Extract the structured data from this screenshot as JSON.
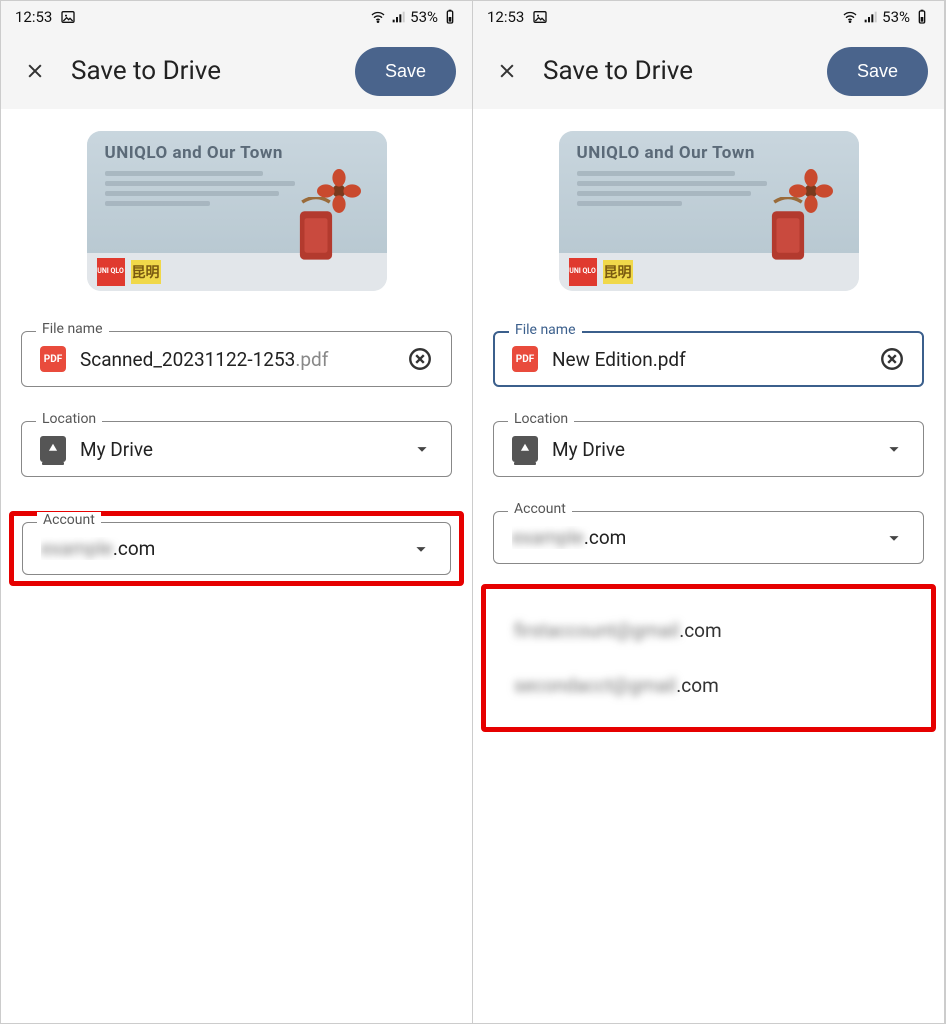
{
  "status": {
    "time": "12:53",
    "battery": "53%"
  },
  "header": {
    "title": "Save to Drive",
    "save_label": "Save"
  },
  "preview": {
    "title": "UNIQLO and Our Town",
    "uniqlo_label": "UNI QLO",
    "kun_label": "昆明"
  },
  "panels": [
    {
      "file_name_label": "File name",
      "file_name": "Scanned_20231122-1253",
      "file_ext": ".pdf",
      "file_focus": false,
      "location_label": "Location",
      "location_value": "My Drive",
      "account_label": "Account",
      "account_masked": "example",
      "account_suffix": ".com",
      "highlight_account_field": true,
      "show_dropdown": false
    },
    {
      "file_name_label": "File name",
      "file_name": "New Edition",
      "file_ext": ".pdf",
      "file_focus": true,
      "location_label": "Location",
      "location_value": "My Drive",
      "account_label": "Account",
      "account_masked": "example",
      "account_suffix": ".com",
      "highlight_account_field": false,
      "show_dropdown": true,
      "dropdown": [
        {
          "masked": "firstaccount@gmail",
          "suffix": ".com"
        },
        {
          "masked": "secondacct@gmail",
          "suffix": ".com"
        }
      ]
    }
  ]
}
